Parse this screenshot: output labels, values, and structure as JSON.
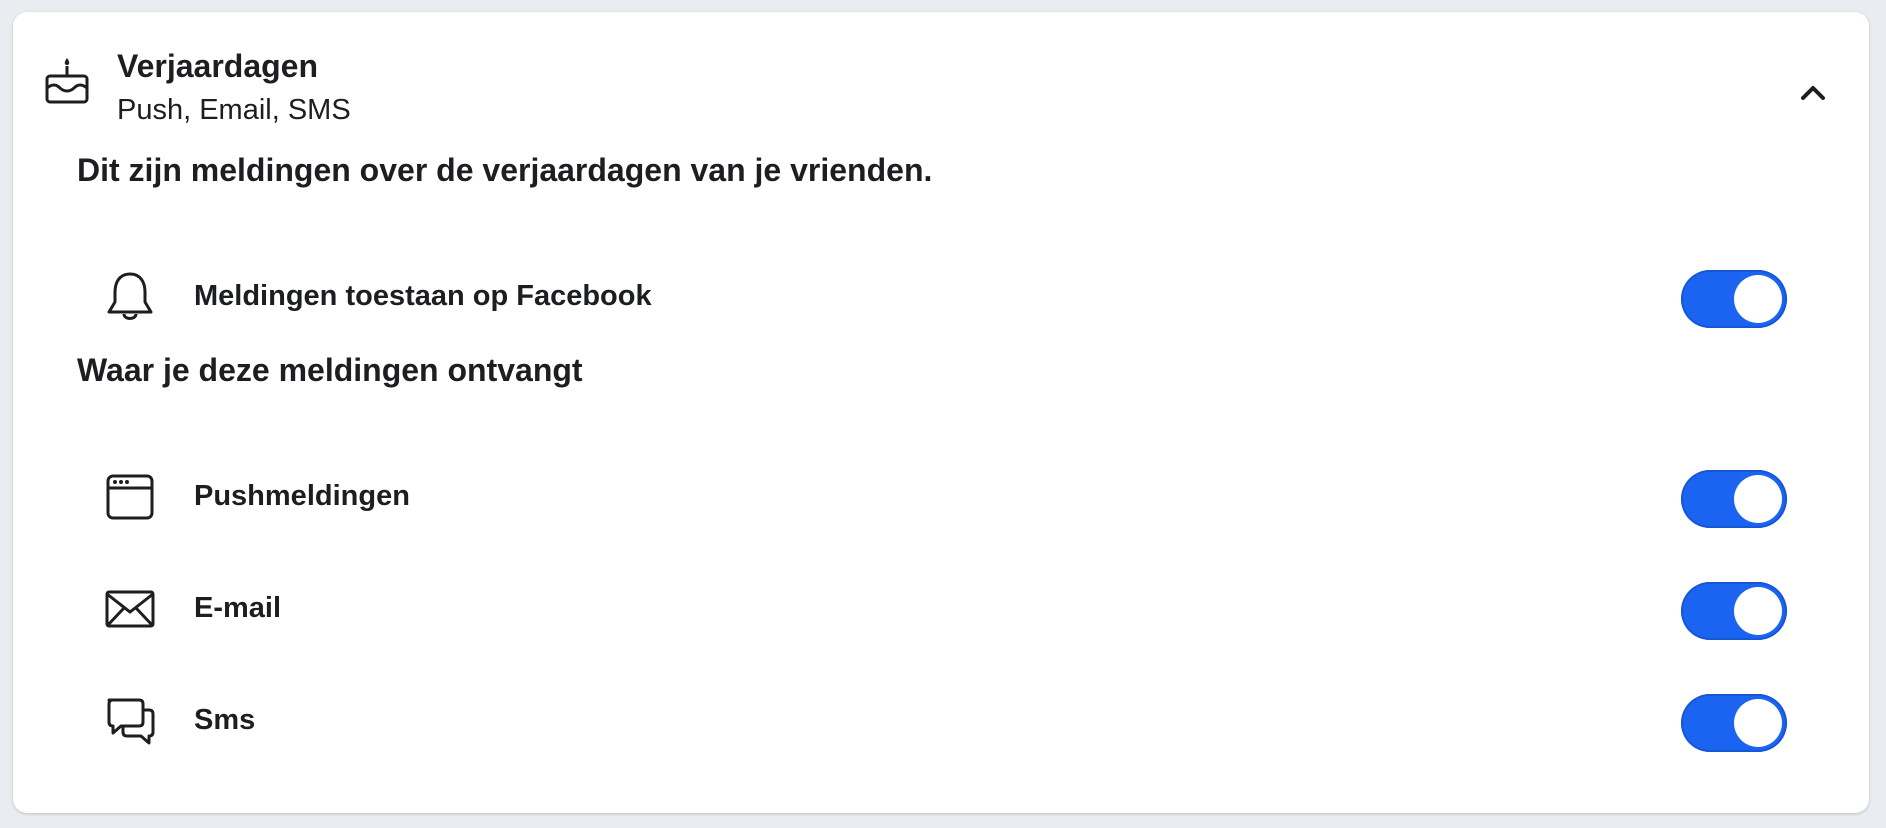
{
  "section": {
    "title": "Verjaardagen",
    "subtitle": "Push, Email, SMS",
    "icon": "birthday-cake-icon",
    "expanded": true
  },
  "description": "Dit zijn meldingen over de verjaardagen van je vrienden.",
  "allow_row": {
    "icon": "bell-icon",
    "label": "Meldingen toestaan op Facebook",
    "enabled": true
  },
  "channels_heading": "Waar je deze meldingen ontvangt",
  "channels": [
    {
      "icon": "browser-window-icon",
      "label": "Pushmeldingen",
      "enabled": true
    },
    {
      "icon": "envelope-icon",
      "label": "E-mail",
      "enabled": true
    },
    {
      "icon": "chat-bubbles-icon",
      "label": "Sms",
      "enabled": true
    }
  ],
  "colors": {
    "toggle_on": "#1b64f2",
    "background": "#e9ecf0",
    "card": "#ffffff"
  }
}
